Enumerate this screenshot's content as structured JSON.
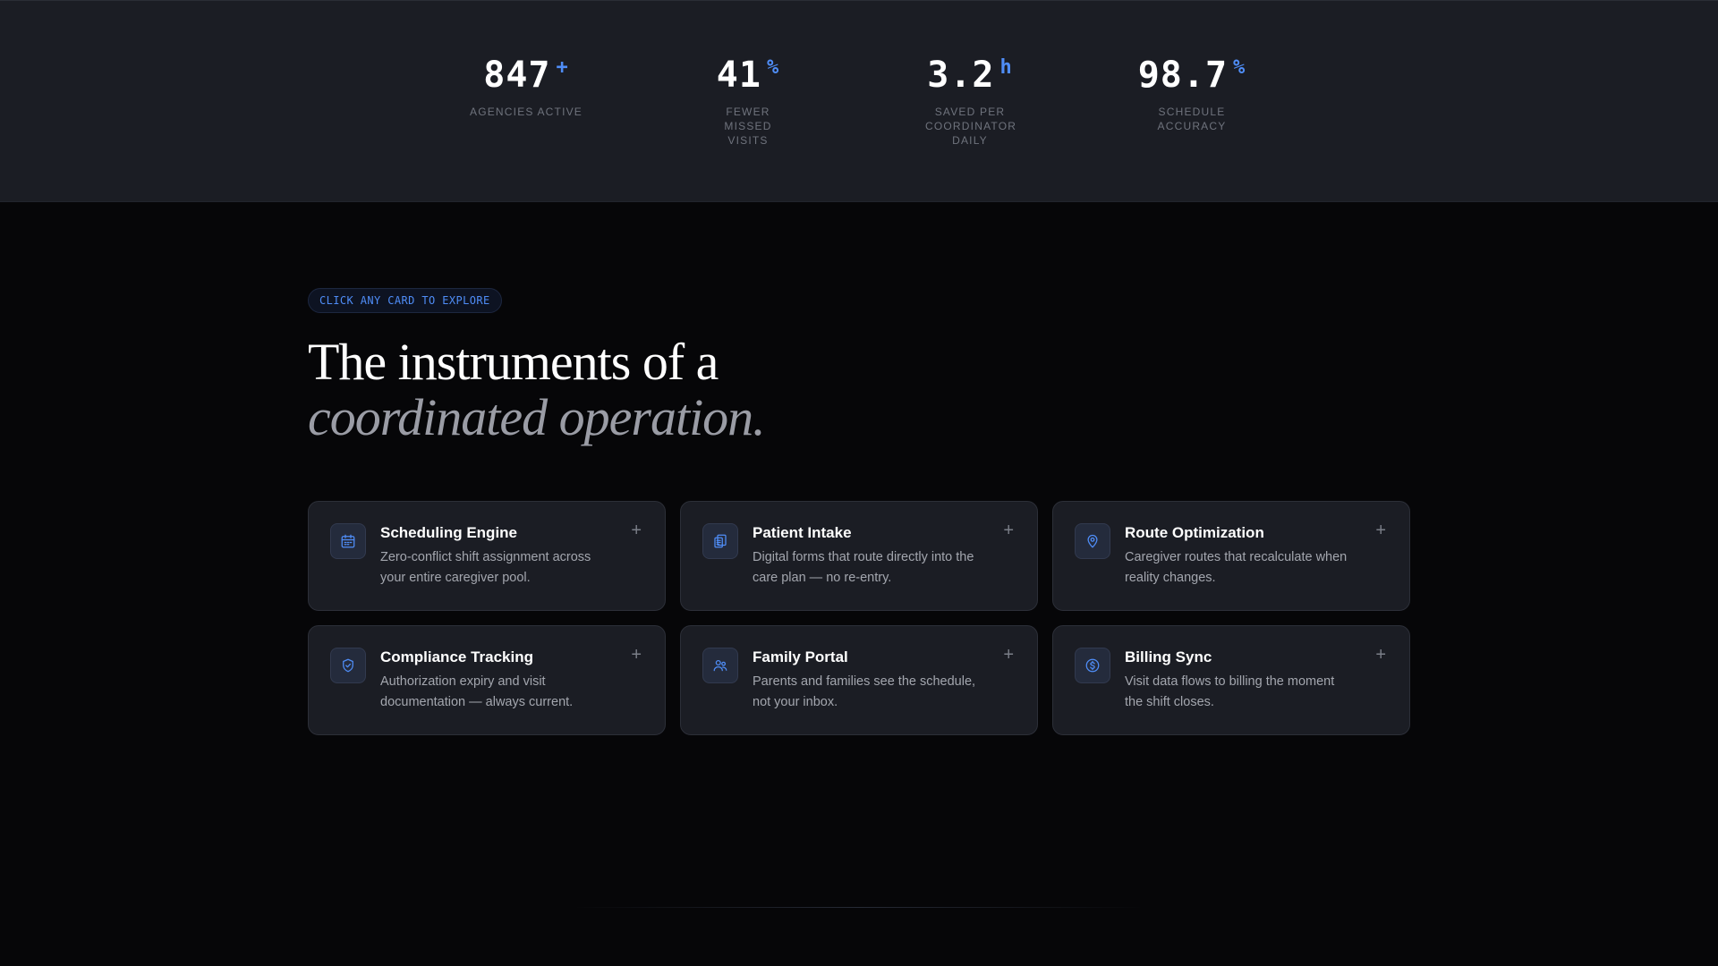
{
  "stats": [
    {
      "value": "847",
      "suffix": "+",
      "label": "Agencies Active"
    },
    {
      "value": "41",
      "suffix": "%",
      "label": "Fewer missed visits"
    },
    {
      "value": "3.2",
      "suffix": "h",
      "label": "Saved per coordinator daily"
    },
    {
      "value": "98.7",
      "suffix": "%",
      "label": "Schedule accuracy"
    }
  ],
  "features": {
    "pill": "CLICK ANY CARD TO EXPLORE",
    "heading_line1": "The instruments of a",
    "heading_line2": "coordinated operation.",
    "cards": [
      {
        "title": "Scheduling Engine",
        "desc": "Zero-conflict shift assignment across your entire caregiver pool.",
        "icon": "calendar-icon"
      },
      {
        "title": "Patient Intake",
        "desc": "Digital forms that route directly into the care plan — no re-entry.",
        "icon": "clipboard-icon"
      },
      {
        "title": "Route Optimization",
        "desc": "Caregiver routes that recalculate when reality changes.",
        "icon": "map-pin-icon"
      },
      {
        "title": "Compliance Tracking",
        "desc": "Authorization expiry and visit documentation — always current.",
        "icon": "shield-check-icon"
      },
      {
        "title": "Family Portal",
        "desc": "Parents and families see the schedule, not your inbox.",
        "icon": "users-icon"
      },
      {
        "title": "Billing Sync",
        "desc": "Visit data flows to billing the moment the shift closes.",
        "icon": "dollar-icon"
      }
    ],
    "expand_symbol": "+"
  },
  "colors": {
    "accent": "#4f8df7",
    "band": "#1b1d24",
    "background": "#060608"
  }
}
